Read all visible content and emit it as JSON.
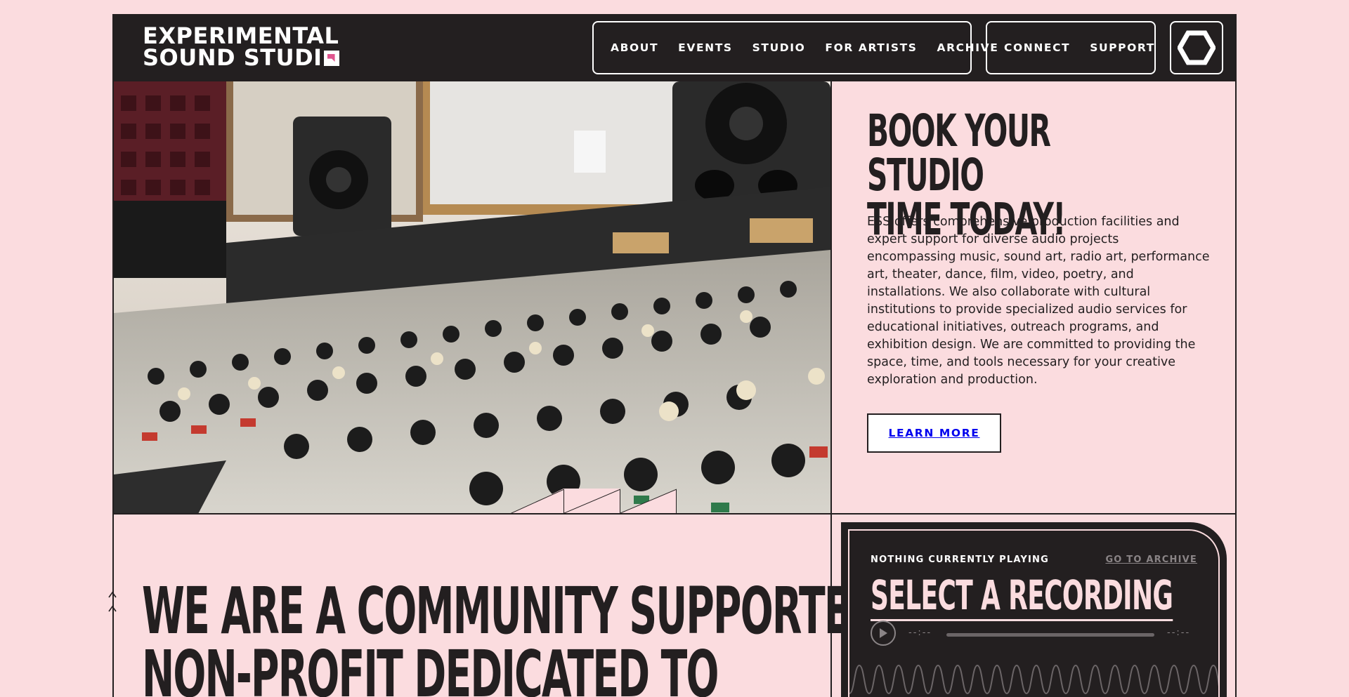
{
  "header": {
    "logo_line1": "EXPERIMENTAL",
    "logo_line2": "SOUND STUDI",
    "nav_primary": [
      "ABOUT",
      "EVENTS",
      "STUDIO",
      "FOR ARTISTS",
      "ARCHIVE"
    ],
    "nav_secondary": [
      "CONNECT",
      "SUPPORT"
    ],
    "menu_icon": "hexagon-icon"
  },
  "hero": {
    "image_icon": "mixing-console-photo"
  },
  "booking": {
    "title_line1": "BOOK YOUR STUDIO",
    "title_line2": "TIME TODAY!",
    "body": "ESS offers comprehensive production facilities and expert support for diverse audio projects encompassing music, sound art, radio art, performance art, theater, dance, film, video, poetry, and installations. We also collaborate with cultural institutions to provide specialized audio services for educational initiatives, outreach programs, and exhibition design. We are committed to providing the space, time, and tools necessary for your creative exploration and production.",
    "button_label": "LEARN MORE"
  },
  "community": {
    "line1": "WE ARE A COMMUNITY SUPPORTED",
    "line2": "NON-PROFIT DEDICATED TO"
  },
  "player": {
    "status": "NOTHING CURRENTLY PLAYING",
    "archive_link": "GO TO ARCHIVE",
    "title": "SELECT A RECORDING",
    "current_time": "--:--",
    "duration": "--:--",
    "progress": 0
  },
  "colors": {
    "background": "#fbdcdf",
    "dark": "#231f20",
    "accent": "#e0568f"
  }
}
